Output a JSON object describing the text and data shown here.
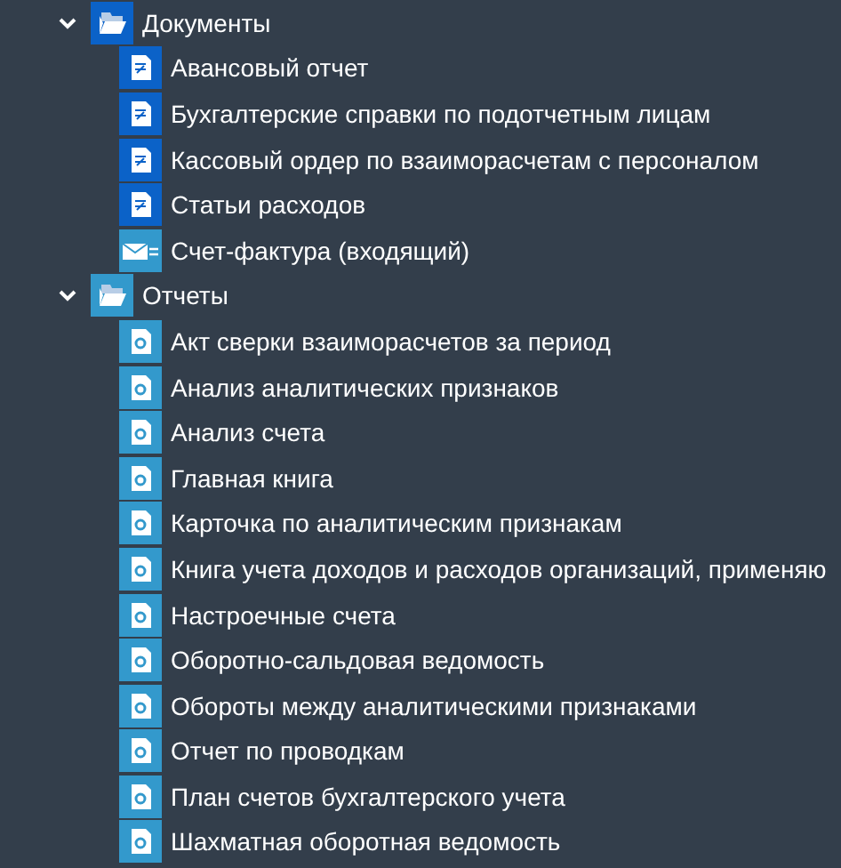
{
  "tree": [
    {
      "label": "Документы",
      "kind": "documents",
      "expanded": true,
      "children": [
        {
          "label": "Авансовый отчет",
          "kind": "document"
        },
        {
          "label": "Бухгалтерские справки по подотчетным лицам",
          "kind": "document"
        },
        {
          "label": "Кассовый ордер по взаиморасчетам с персоналом",
          "kind": "document"
        },
        {
          "label": "Статьи расходов",
          "kind": "document"
        },
        {
          "label": "Счет-фактура (входящий)",
          "kind": "invoice"
        }
      ]
    },
    {
      "label": "Отчеты",
      "kind": "reports",
      "expanded": true,
      "children": [
        {
          "label": "Акт сверки взаиморасчетов за период",
          "kind": "report"
        },
        {
          "label": "Анализ аналитических признаков",
          "kind": "report"
        },
        {
          "label": "Анализ счета",
          "kind": "report"
        },
        {
          "label": "Главная книга",
          "kind": "report"
        },
        {
          "label": "Карточка по аналитическим признакам",
          "kind": "report"
        },
        {
          "label": "Книга учета доходов и расходов организаций, применяю",
          "kind": "report"
        },
        {
          "label": "Настроечные счета",
          "kind": "report"
        },
        {
          "label": "Оборотно-сальдовая ведомость",
          "kind": "report"
        },
        {
          "label": "Обороты между аналитическими признаками",
          "kind": "report"
        },
        {
          "label": "Отчет по проводкам",
          "kind": "report"
        },
        {
          "label": "План счетов бухгалтерского учета",
          "kind": "report"
        },
        {
          "label": "Шахматная оборотная ведомость",
          "kind": "report"
        }
      ]
    }
  ]
}
